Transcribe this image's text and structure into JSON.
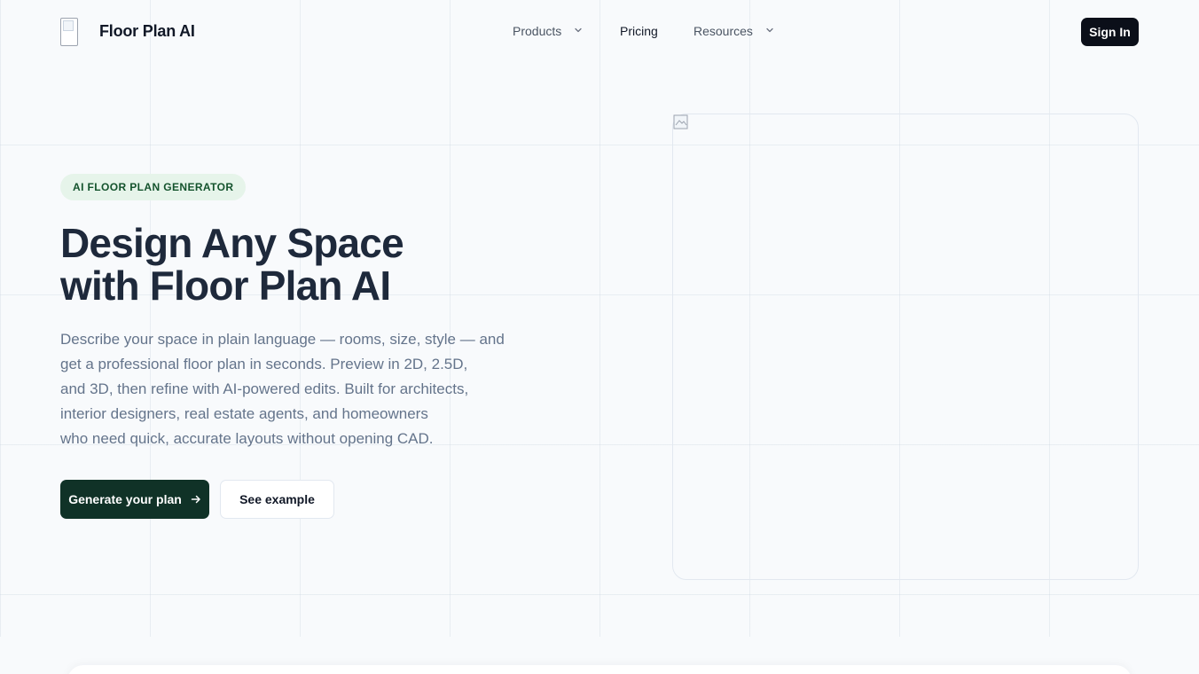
{
  "header": {
    "brand": "Floor Plan AI",
    "nav": [
      {
        "label": "Products",
        "has_dropdown": true
      },
      {
        "label": "Pricing",
        "has_dropdown": false
      },
      {
        "label": "Resources",
        "has_dropdown": true
      }
    ],
    "sign_in_label": "Sign In"
  },
  "hero": {
    "badge": "AI FLOOR PLAN GENERATOR",
    "headline": [
      "Design Any Space",
      "with Floor Plan AI"
    ],
    "description": [
      "Describe your space in plain language — rooms, size, style — and",
      "get a professional floor plan in seconds. Preview in 2D, 2.5D,",
      "and 3D, then refine with AI-powered edits. Built for architects,",
      "interior designers, real estate agents, and homeowners",
      "who need quick, accurate layouts without opening CAD."
    ],
    "primary_cta": "Generate your plan",
    "secondary_cta": "See example"
  },
  "colors": {
    "primary_button": "#103227",
    "sign_in_button": "#0b0f19",
    "badge_bg": "#e6f4ea",
    "badge_text": "#14532d",
    "page_bg": "#f8fafc"
  },
  "icons": {
    "logo": "broken-image-icon",
    "chevron": "chevron-down-icon",
    "arrow": "arrow-right-icon",
    "preview": "broken-image-icon"
  }
}
